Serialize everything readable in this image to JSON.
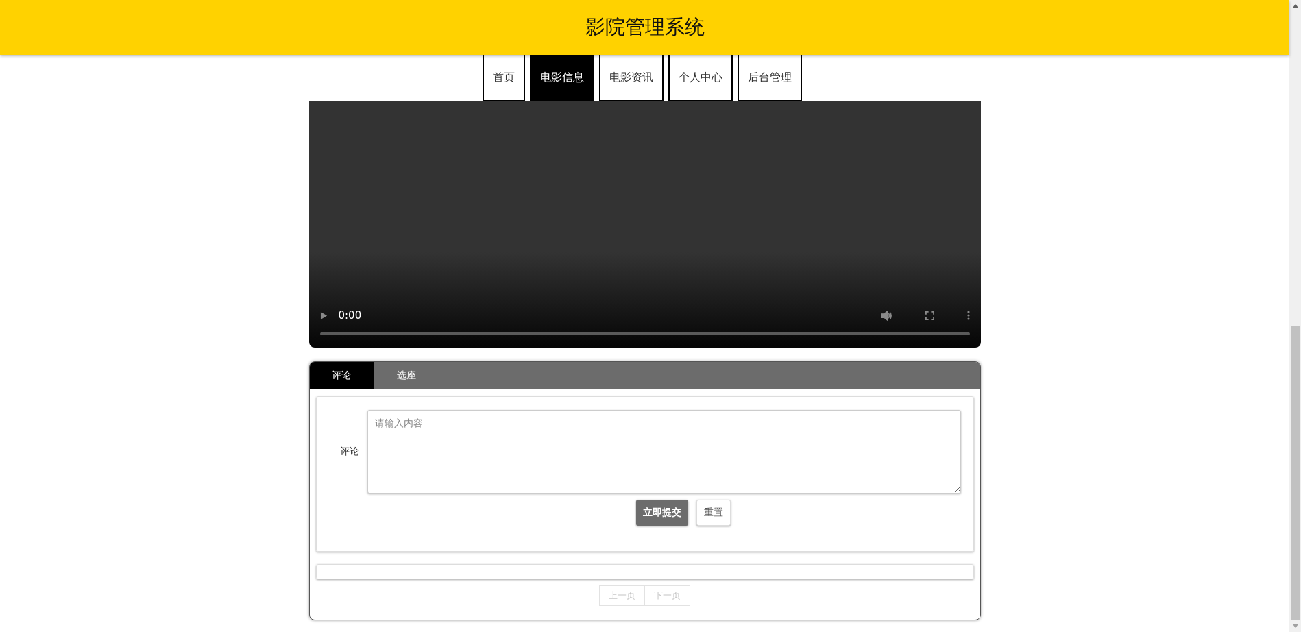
{
  "header": {
    "title": "影院管理系统"
  },
  "nav": [
    {
      "label": "首页",
      "selected": false
    },
    {
      "label": "电影信息",
      "selected": true
    },
    {
      "label": "电影资讯",
      "selected": false
    },
    {
      "label": "个人中心",
      "selected": false
    },
    {
      "label": "后台管理",
      "selected": false
    }
  ],
  "video": {
    "time": "0:00"
  },
  "tabs": [
    {
      "label": "评论",
      "selected": true
    },
    {
      "label": "选座",
      "selected": false
    }
  ],
  "comment_form": {
    "label": "评论",
    "placeholder": "请输入内容",
    "buttons": [
      {
        "label": "立即提交",
        "kind": "primary"
      },
      {
        "label": "重置",
        "kind": "plain"
      }
    ]
  },
  "pagination": [
    {
      "label": "上一页",
      "disabled": true
    },
    {
      "label": "下一页",
      "disabled": true
    }
  ]
}
